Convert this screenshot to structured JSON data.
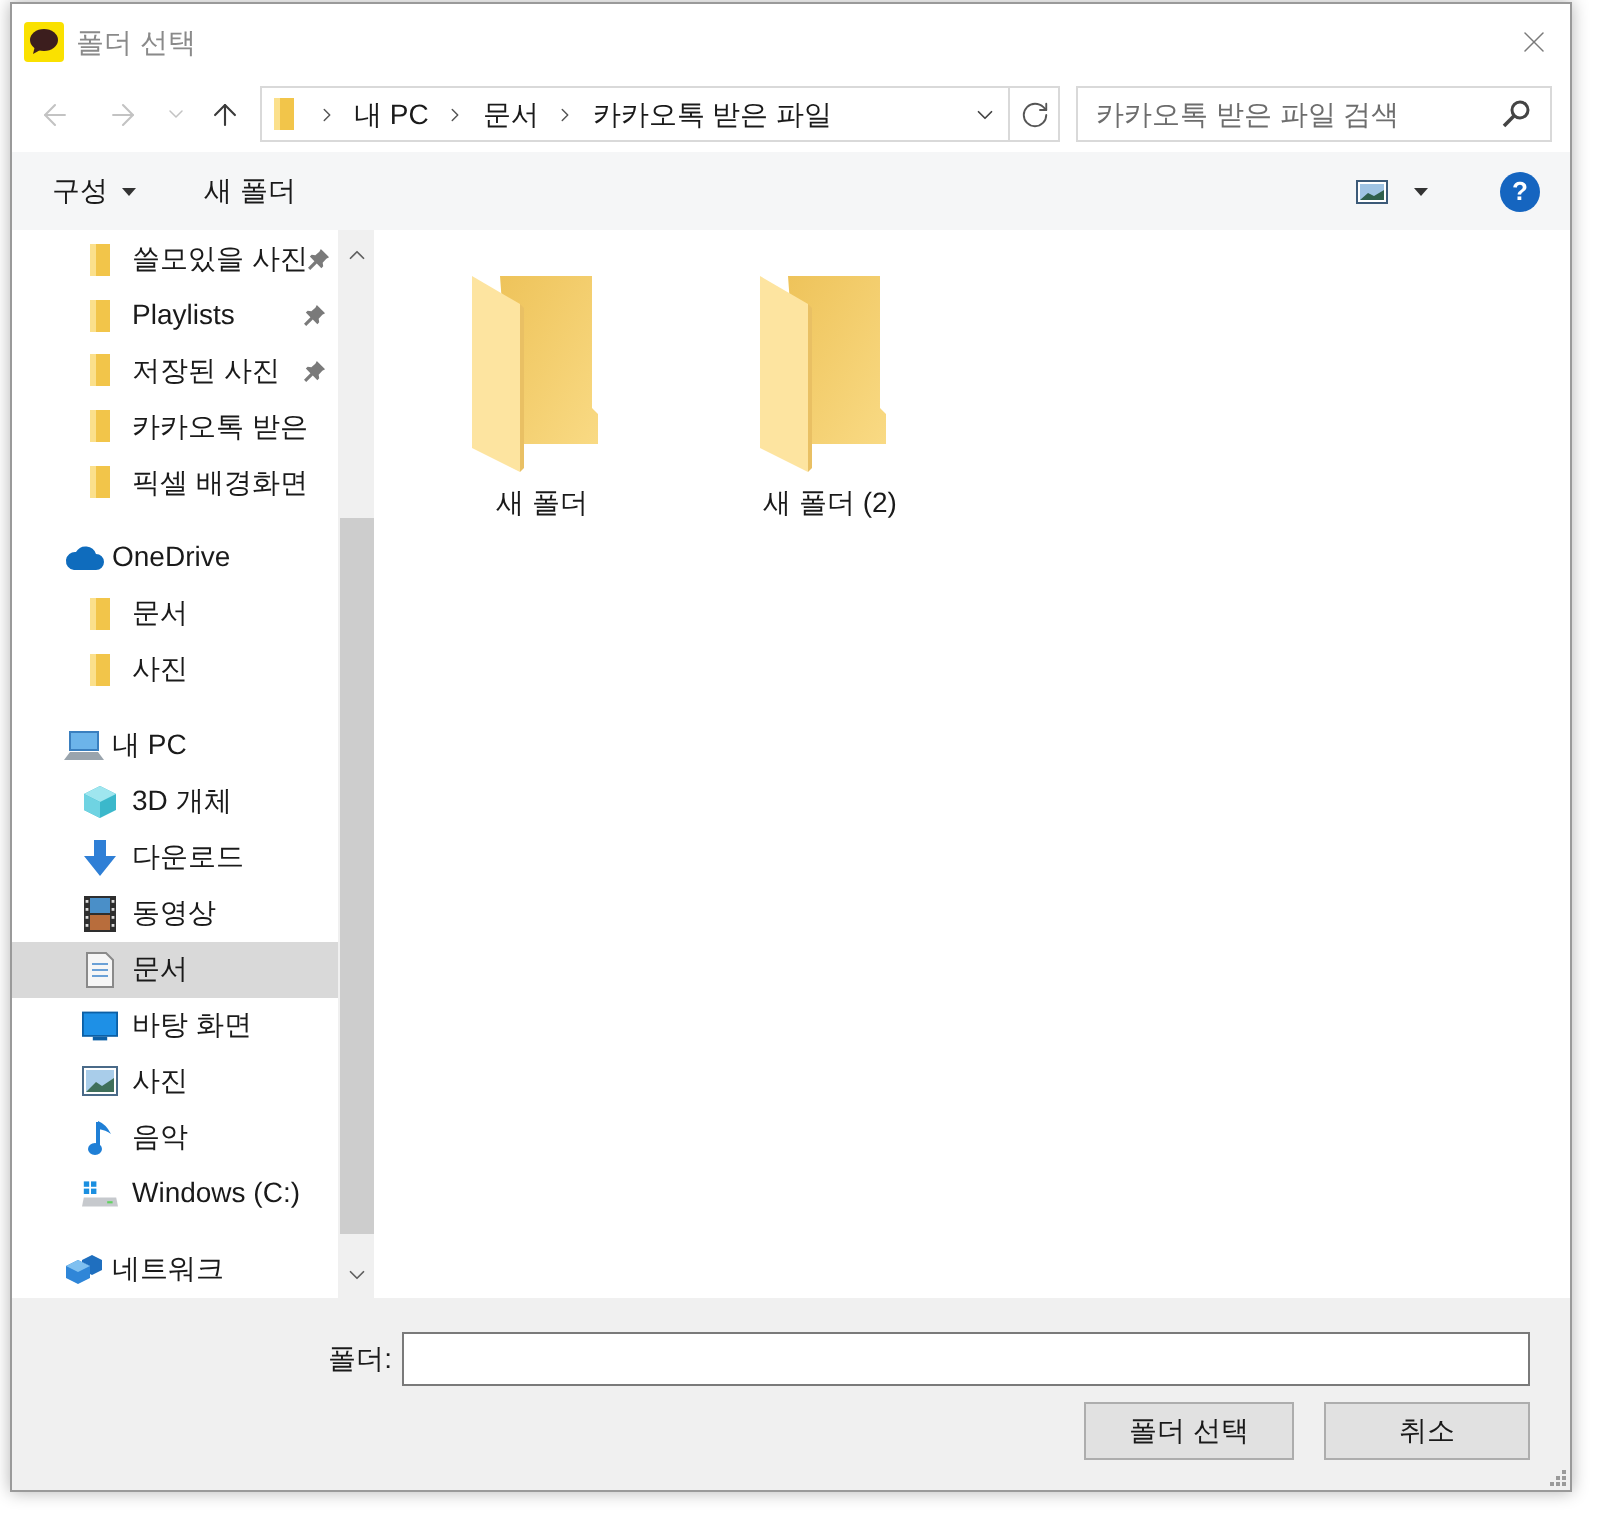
{
  "window": {
    "title": "폴더 선택"
  },
  "navigation": [
    {
      "kind": "back",
      "disabled": true
    },
    {
      "kind": "forward",
      "disabled": true
    },
    {
      "kind": "recent",
      "disabled": true
    },
    {
      "kind": "up",
      "disabled": false
    }
  ],
  "address_bar": {
    "breadcrumbs": [
      "내 PC",
      "문서",
      "카카오톡 받은 파일"
    ]
  },
  "search": {
    "placeholder": "카카오톡 받은 파일 검색"
  },
  "toolbar": {
    "organize": "구성",
    "new_folder": "새 폴더",
    "help": "?"
  },
  "nav_pane": {
    "quick_access": [
      {
        "label": "쓸모있을 사진",
        "pinned": true,
        "selected": false
      },
      {
        "label": "Playlists",
        "pinned": true,
        "selected": false
      },
      {
        "label": "저장된 사진",
        "pinned": true,
        "selected": false
      },
      {
        "label": "카카오톡 받은",
        "pinned": false,
        "selected": false
      },
      {
        "label": "픽셀 배경화면",
        "pinned": false,
        "selected": false
      }
    ],
    "locations": [
      {
        "label": "OneDrive",
        "kind": "cloud",
        "selected": false,
        "children": [
          {
            "label": "문서",
            "kind": "folder",
            "selected": false
          },
          {
            "label": "사진",
            "kind": "folder",
            "selected": false
          }
        ]
      },
      {
        "label": "내 PC",
        "kind": "computer",
        "selected": false,
        "children": [
          {
            "label": "3D 개체",
            "kind": "cube",
            "selected": false
          },
          {
            "label": "다운로드",
            "kind": "download",
            "selected": false
          },
          {
            "label": "동영상",
            "kind": "video",
            "selected": false
          },
          {
            "label": "문서",
            "kind": "document",
            "selected": true
          },
          {
            "label": "바탕 화면",
            "kind": "desktop",
            "selected": false
          },
          {
            "label": "사진",
            "kind": "picture",
            "selected": false
          },
          {
            "label": "음악",
            "kind": "music",
            "selected": false
          },
          {
            "label": "Windows (C:)",
            "kind": "drive",
            "selected": false
          }
        ]
      },
      {
        "label": "네트워크",
        "kind": "network",
        "selected": false
      }
    ]
  },
  "folders": [
    {
      "name": "새 폴더",
      "selected": false
    },
    {
      "name": "새 폴더 (2)",
      "selected": false
    }
  ],
  "footer": {
    "folder_label": "폴더:",
    "buttons": [
      "폴더 선택",
      "취소"
    ]
  }
}
